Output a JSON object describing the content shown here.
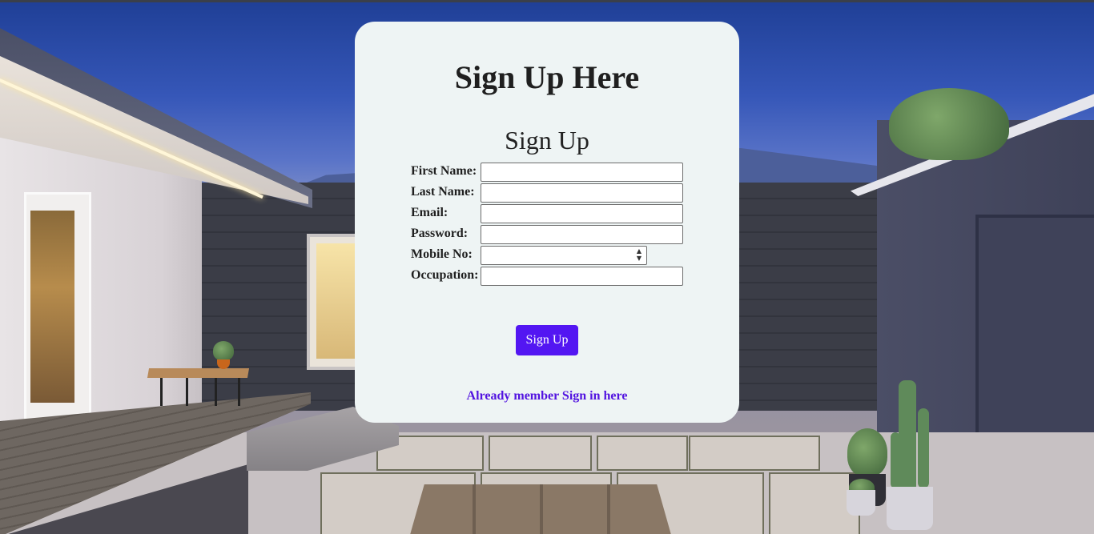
{
  "page": {
    "heading": "Sign Up Here",
    "form_title": "Sign Up"
  },
  "form": {
    "fields": [
      {
        "label": "First Name:",
        "value": "",
        "type": "text"
      },
      {
        "label": "Last Name:",
        "value": "",
        "type": "text"
      },
      {
        "label": "Email:",
        "value": "",
        "type": "email"
      },
      {
        "label": "Password:",
        "value": "",
        "type": "password"
      },
      {
        "label": "Mobile No:",
        "value": "",
        "type": "number"
      },
      {
        "label": "Occupation:",
        "value": "",
        "type": "text"
      }
    ],
    "submit_label": "Sign Up",
    "signin_link": "Already member Sign in here"
  },
  "colors": {
    "card_background": "#eef4f4",
    "button_background": "#5316f2",
    "link_color": "#5314e0"
  },
  "icons": {
    "number_spinner": "spinner-arrows-icon"
  }
}
